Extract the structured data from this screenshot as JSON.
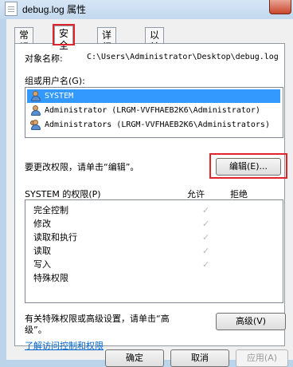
{
  "window": {
    "title": "debug.log 属性"
  },
  "tabs": [
    {
      "label": "常规"
    },
    {
      "label": "安全"
    },
    {
      "label": "详细信息"
    },
    {
      "label": "以前的版本"
    }
  ],
  "security": {
    "object_label": "对象名称:",
    "object_path": "C:\\Users\\Administrator\\Desktop\\debug.log",
    "group_label": "组或用户名(G):",
    "users": [
      {
        "name": "SYSTEM"
      },
      {
        "name": "Administrator (LRGM-VVFHAEB2K6\\Administrator)"
      },
      {
        "name": "Administrators (LRGM-VVFHAEB2K6\\Administrators)"
      }
    ],
    "edit_hint": "要更改权限，请单击“编辑”。",
    "edit_button": "编辑(E)...",
    "perm_header": "SYSTEM 的权限(P)",
    "allow_header": "允许",
    "deny_header": "拒绝",
    "permissions": [
      {
        "name": "完全控制",
        "allow_mark": "✓"
      },
      {
        "name": "修改",
        "allow_mark": "✓"
      },
      {
        "name": "读取和执行",
        "allow_mark": "✓"
      },
      {
        "name": "读取",
        "allow_mark": "✓"
      },
      {
        "name": "写入",
        "allow_mark": "✓"
      },
      {
        "name": "特殊权限",
        "allow_mark": ""
      }
    ],
    "advanced_hint_line1": "有关特殊权限或高级设置，请单击“高",
    "advanced_hint_line2": "级”。",
    "advanced_button": "高级(V)",
    "learn_link": "了解访问控制和权限"
  },
  "footer": {
    "ok": "确定",
    "cancel": "取消",
    "apply": "应用(A)"
  }
}
